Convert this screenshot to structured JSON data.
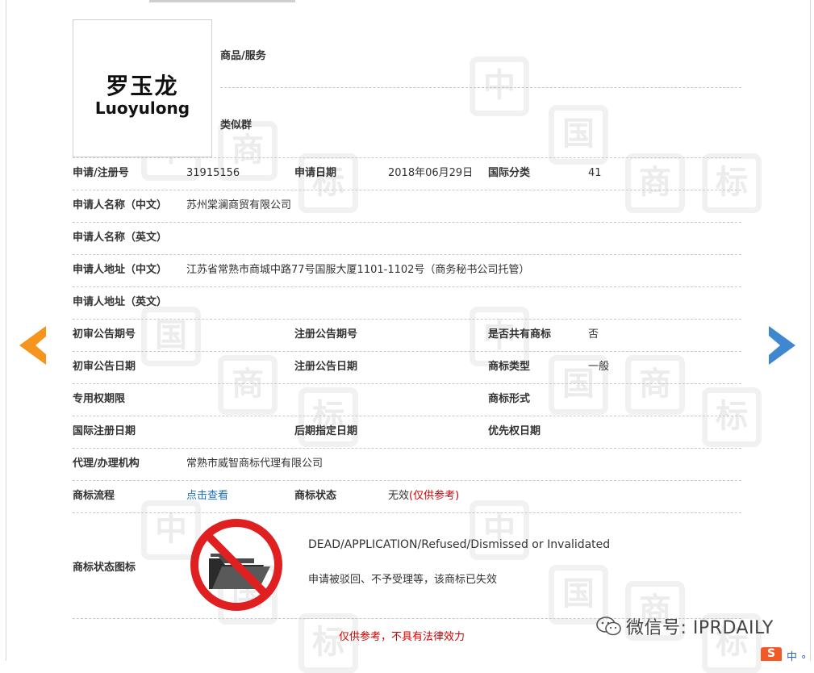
{
  "logo": {
    "cn": "罗玉龙",
    "en": "Luoyulong"
  },
  "watermark_chars": [
    "中",
    "国",
    "商",
    "标"
  ],
  "goods_services_label": "商品/服务",
  "similar_group_label": "类似群",
  "rows": [
    {
      "cells": [
        {
          "text": "申请/注册号",
          "type": "label"
        },
        {
          "text": "31915156",
          "type": "value"
        },
        {
          "text": "申请日期",
          "type": "label"
        },
        {
          "text": "2018年06月29日",
          "type": "value"
        },
        {
          "text": "国际分类",
          "type": "label"
        },
        {
          "text": "41",
          "type": "value"
        }
      ]
    },
    {
      "cells": [
        {
          "text": "申请人名称（中文）",
          "type": "label"
        },
        {
          "text": "苏州棠澜商贸有限公司",
          "type": "value"
        }
      ]
    },
    {
      "cells": [
        {
          "text": "申请人名称（英文）",
          "type": "label"
        }
      ]
    },
    {
      "cells": [
        {
          "text": "申请人地址（中文）",
          "type": "label"
        },
        {
          "text": "江苏省常熟市商城中路77号国服大厦1101-1102号（商务秘书公司托管）",
          "type": "value"
        }
      ]
    },
    {
      "cells": [
        {
          "text": "申请人地址（英文）",
          "type": "label"
        }
      ]
    },
    {
      "cells": [
        {
          "text": "初审公告期号",
          "type": "label"
        },
        {
          "text": "",
          "type": "value"
        },
        {
          "text": "注册公告期号",
          "type": "label"
        },
        {
          "text": "",
          "type": "value"
        },
        {
          "text": "是否共有商标",
          "type": "label"
        },
        {
          "text": "否",
          "type": "value"
        }
      ]
    },
    {
      "cells": [
        {
          "text": "初审公告日期",
          "type": "label"
        },
        {
          "text": "",
          "type": "value"
        },
        {
          "text": "注册公告日期",
          "type": "label"
        },
        {
          "text": "",
          "type": "value"
        },
        {
          "text": "商标类型",
          "type": "label"
        },
        {
          "text": "一般",
          "type": "value"
        }
      ]
    },
    {
      "cells": [
        {
          "text": "专用权期限",
          "type": "label"
        },
        {
          "text": "",
          "type": "value"
        },
        {
          "text": "",
          "type": "label"
        },
        {
          "text": "",
          "type": "value"
        },
        {
          "text": "商标形式",
          "type": "label"
        },
        {
          "text": "",
          "type": "value"
        }
      ]
    },
    {
      "cells": [
        {
          "text": "国际注册日期",
          "type": "label"
        },
        {
          "text": "",
          "type": "value"
        },
        {
          "text": "后期指定日期",
          "type": "label"
        },
        {
          "text": "",
          "type": "value"
        },
        {
          "text": "优先权日期",
          "type": "label"
        },
        {
          "text": "",
          "type": "value"
        }
      ]
    },
    {
      "cells": [
        {
          "text": "代理/办理机构",
          "type": "label"
        },
        {
          "text": "常熟市威智商标代理有限公司",
          "type": "value"
        }
      ]
    },
    {
      "cells": [
        {
          "text": "商标流程",
          "type": "label"
        },
        {
          "text": "点击查看",
          "type": "link"
        },
        {
          "text": "商标状态",
          "type": "label"
        },
        {
          "text": "无效",
          "type": "value",
          "extra": "(仅供参考)"
        }
      ]
    }
  ],
  "status_icon": {
    "label": "商标状态图标",
    "icon": "invalid-folder-icon",
    "en": "DEAD/APPLICATION/Refused/Dismissed or Invalidated",
    "cn": "申请被驳回、不予受理等，该商标已失效"
  },
  "footer_note": "仅供参考，不具有法律效力",
  "wechat": {
    "icon": "wechat-icon",
    "text": "微信号: IPRDAILY"
  },
  "sogou": {
    "badge": "S",
    "text": "中 ∘"
  },
  "colors": {
    "label": "#333333",
    "link": "#1a6fc0",
    "red": "#d40000",
    "arrow_prev": "#f7941d",
    "arrow_next": "#3f88d0"
  }
}
